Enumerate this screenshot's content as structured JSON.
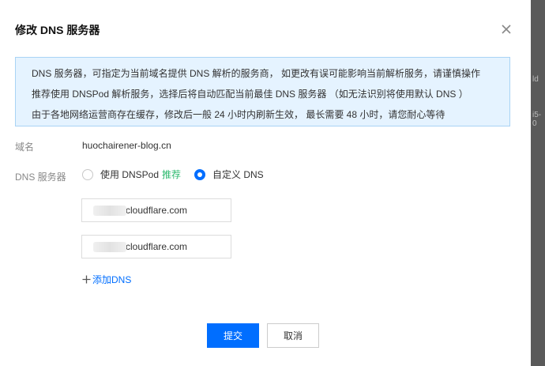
{
  "dialog": {
    "title": "修改 DNS 服务器"
  },
  "notice": {
    "lines": [
      "DNS 服务器，可指定为当前域名提供 DNS 解析的服务商， 如更改有误可能影响当前解析服务，请谨慎操作",
      "推荐使用 DNSPod 解析服务，选择后将自动匹配当前最佳 DNS 服务器 （如无法识别将使用默认 DNS ）",
      "由于各地网络运营商存在缓存，修改后一般 24 小时内刷新生效， 最长需要 48 小时，请您耐心等待"
    ]
  },
  "form": {
    "domain_label": "域名",
    "domain_value": "huochairener-blog.cn",
    "dns_label": "DNS 服务器",
    "option_dnspod": "使用 DNSPod",
    "option_dnspod_badge": "推荐",
    "option_custom": "自定义 DNS",
    "selected_option": "custom",
    "dns_inputs": [
      "cloudflare.com",
      "cloudflare.com"
    ],
    "add_dns": "添加DNS"
  },
  "buttons": {
    "submit": "提交",
    "cancel": "取消"
  },
  "backdrop": {
    "fragments": [
      "ld",
      "i5-0"
    ]
  },
  "colors": {
    "primary": "#006eff",
    "recommend": "#2db96e",
    "notice_bg": "#e5f3ff",
    "notice_border": "#a9d3f5"
  },
  "icons": {
    "close": "close-icon",
    "add": "plus-icon"
  }
}
